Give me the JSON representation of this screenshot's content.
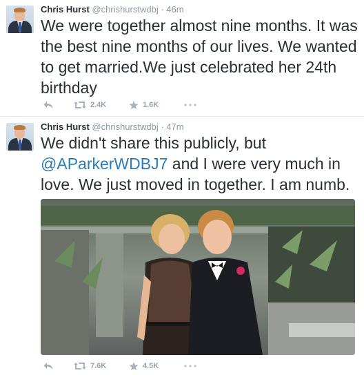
{
  "tweets": [
    {
      "author_name": "Chris Hurst",
      "author_handle": "@chrishurstwdbj",
      "separator": "·",
      "time": "46m",
      "text": "We were together almost nine months. It was the best nine months of our lives. We wanted to get married.We just celebrated her 24th birthday",
      "retweets": "2.4K",
      "favorites": "1.6K",
      "icons": {
        "reply": "reply-icon",
        "retweet": "retweet-icon",
        "favorite": "star-icon",
        "more": "more-icon"
      }
    },
    {
      "author_name": "Chris Hurst",
      "author_handle": "@chrishurstwdbj",
      "separator": "·",
      "time": "47m",
      "text_before": "We didn't share this publicly, but ",
      "mention": "@AParkerWDBJ7",
      "text_after": " and I were very much in love. We just moved in together. I am numb.",
      "retweets": "7.6K",
      "favorites": "4.5K",
      "icons": {
        "reply": "reply-icon",
        "retweet": "retweet-icon",
        "favorite": "star-icon",
        "more": "more-icon"
      }
    }
  ],
  "colors": {
    "text": "#292f33",
    "meta": "#8899a6",
    "link": "#2b7bb9",
    "action": "#99a3ad",
    "divider": "#e1e8ed"
  }
}
